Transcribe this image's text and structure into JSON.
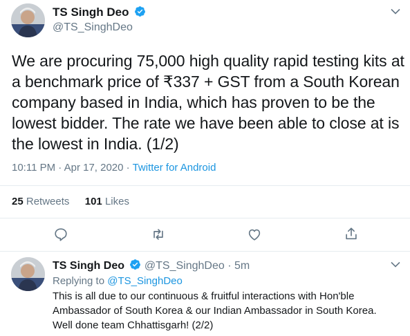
{
  "tweet": {
    "display_name": "TS Singh Deo",
    "handle": "@TS_SinghDeo",
    "text": "We are procuring 75,000 high quality rapid testing kits at a benchmark price of ₹337 + GST from a South Korean company based in India, which has proven to be the lowest bidder. The rate we have been able to close at is the lowest in India. (1/2)",
    "time": "10:11 PM · Apr 17, 2020 · ",
    "source": "Twitter for Android",
    "retweets_count": "25",
    "retweets_label": "Retweets",
    "likes_count": "101",
    "likes_label": "Likes"
  },
  "reply": {
    "display_name": "TS Singh Deo",
    "handle_time": "@TS_SinghDeo · 5m",
    "replying_to_label": "Replying to ",
    "replying_to_handle": "@TS_SinghDeo",
    "text": "This is all due to our continuous & fruitful interactions with Hon'ble Ambassador of South Korea & our Indian Ambassador in South Korea. Well done team Chhattisgarh! (2/2)"
  },
  "icons": [
    "verified-icon",
    "chevron-down-icon",
    "reply-icon",
    "retweet-icon",
    "like-icon",
    "share-icon"
  ],
  "colors": {
    "accent": "#1b95e0",
    "text": "#14171a",
    "muted": "#657786",
    "border": "#e6ecf0"
  }
}
